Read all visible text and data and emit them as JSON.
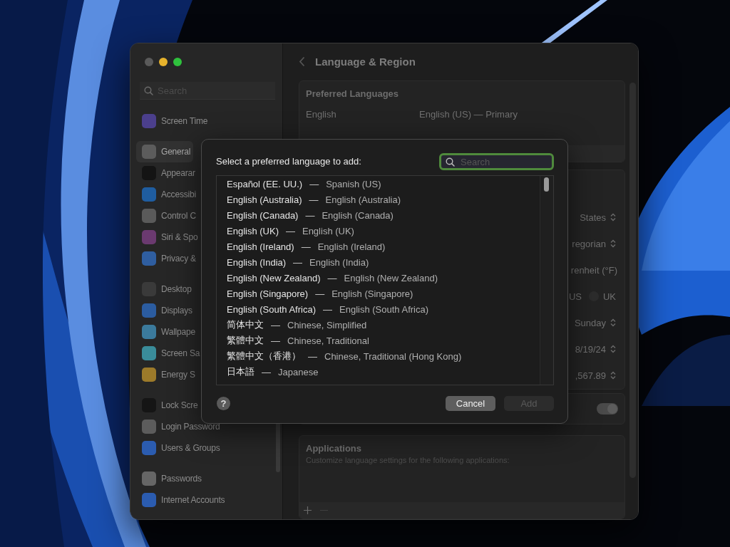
{
  "sidebar": {
    "search": {
      "placeholder": "Search"
    },
    "groups": [
      {
        "items": [
          {
            "label": "Screen Time",
            "color": "#4b3f8c",
            "selected": false
          }
        ]
      },
      {
        "items": [
          {
            "label": "General",
            "color": "#5c5c5c",
            "selected": true
          },
          {
            "label": "Appearar",
            "color": "#141414",
            "selected": false
          },
          {
            "label": "Accessibi",
            "color": "#1f5da0",
            "selected": false
          },
          {
            "label": "Control C",
            "color": "#5a5a5a",
            "selected": false
          },
          {
            "label": "Siri & Spo",
            "color": "#6b3a70",
            "selected": false
          },
          {
            "label": "Privacy &",
            "color": "#2f5ea0",
            "selected": false
          }
        ]
      },
      {
        "items": [
          {
            "label": "Desktop",
            "color": "#3a3a3a",
            "selected": false
          },
          {
            "label": "Displays",
            "color": "#2b5ca0",
            "selected": false
          },
          {
            "label": "Wallpape",
            "color": "#3b7a9c",
            "selected": false
          },
          {
            "label": "Screen Sa",
            "color": "#3a8c9a",
            "selected": false
          },
          {
            "label": "Energy S",
            "color": "#9c7a2a",
            "selected": false
          }
        ]
      },
      {
        "items": [
          {
            "label": "Lock Scre",
            "color": "#151515",
            "selected": false
          },
          {
            "label": "Login Password",
            "color": "#5c5c5c",
            "selected": false
          },
          {
            "label": "Users & Groups",
            "color": "#2b5cb0",
            "selected": false
          }
        ]
      },
      {
        "items": [
          {
            "label": "Passwords",
            "color": "#666666",
            "selected": false
          },
          {
            "label": "Internet Accounts",
            "color": "#2b5cb0",
            "selected": false
          }
        ]
      }
    ]
  },
  "main": {
    "title": "Language & Region",
    "preferred_languages": {
      "heading": "Preferred Languages",
      "rows": [
        {
          "language": "English",
          "detail": "English (US) — Primary"
        }
      ]
    },
    "region_rows": [
      {
        "kind": "popup",
        "value": "States"
      },
      {
        "kind": "popup",
        "value": "regorian"
      },
      {
        "kind": "plain",
        "value": "renheit (°F)"
      },
      {
        "kind": "radio",
        "options": [
          {
            "label": "US"
          },
          {
            "label": "UK",
            "selected": false
          }
        ]
      },
      {
        "kind": "popup",
        "value": "Sunday"
      },
      {
        "kind": "popup",
        "value": "8/19/24"
      },
      {
        "kind": "popup",
        "value": ",567.89"
      }
    ],
    "toggle": {
      "on": true
    },
    "applications": {
      "heading": "Applications",
      "description": "Customize language settings for the following applications:"
    }
  },
  "dialog": {
    "prompt": "Select a preferred language to add:",
    "search": {
      "placeholder": "Search",
      "focused": true
    },
    "languages": [
      {
        "native": "Español (EE. UU.)",
        "separator": "—",
        "english": "Spanish (US)"
      },
      {
        "native": "English (Australia)",
        "separator": "—",
        "english": "English (Australia)"
      },
      {
        "native": "English (Canada)",
        "separator": "—",
        "english": "English (Canada)"
      },
      {
        "native": "English (UK)",
        "separator": "—",
        "english": "English (UK)"
      },
      {
        "native": "English (Ireland)",
        "separator": "—",
        "english": "English (Ireland)"
      },
      {
        "native": "English (India)",
        "separator": "—",
        "english": "English (India)"
      },
      {
        "native": "English (New Zealand)",
        "separator": "—",
        "english": "English (New Zealand)"
      },
      {
        "native": "English (Singapore)",
        "separator": "—",
        "english": "English (Singapore)"
      },
      {
        "native": "English (South Africa)",
        "separator": "—",
        "english": "English (South Africa)"
      },
      {
        "native": "简体中文",
        "separator": "—",
        "english": "Chinese, Simplified"
      },
      {
        "native": "繁體中文",
        "separator": "—",
        "english": "Chinese, Traditional"
      },
      {
        "native": "繁體中文（香港）",
        "separator": "—",
        "english": "Chinese, Traditional (Hong Kong)"
      },
      {
        "native": "日本語",
        "separator": "—",
        "english": "Japanese"
      }
    ],
    "help": "?",
    "buttons": [
      {
        "label": "Cancel",
        "disabled": false
      },
      {
        "label": "Add",
        "disabled": true
      }
    ]
  }
}
